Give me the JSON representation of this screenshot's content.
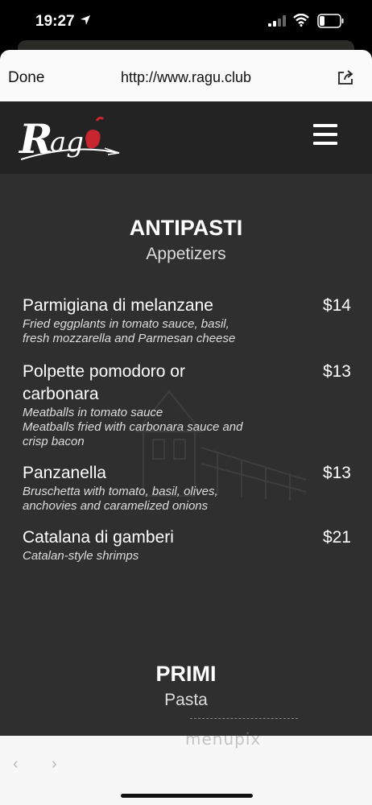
{
  "status_bar": {
    "time": "19:27"
  },
  "browser": {
    "done_label": "Done",
    "url": "http://www.ragu.club"
  },
  "site": {
    "logo_text": "Ragù"
  },
  "sections": [
    {
      "title": "ANTIPASTI",
      "subtitle": "Appetizers",
      "items": [
        {
          "name": "Parmigiana di melanzane",
          "price": "$14",
          "desc": [
            "Fried eggplants in tomato sauce, basil,",
            "fresh mozzarella and Parmesan cheese"
          ]
        },
        {
          "name": "Polpette pomodoro or carbonara",
          "price": "$13",
          "desc": [
            "Meatballs in tomato sauce",
            "Meatballs fried with carbonara sauce and",
            "crisp bacon"
          ]
        },
        {
          "name": "Panzanella",
          "price": "$13",
          "desc": [
            "Bruschetta with tomato, basil, olives,",
            "anchovies and caramelized onions"
          ]
        },
        {
          "name": "Catalana di gamberi",
          "price": "$21",
          "desc": [
            "Catalan-style shrimps"
          ]
        }
      ]
    },
    {
      "title": "PRIMI",
      "subtitle": "Pasta"
    }
  ],
  "watermark": "menupix"
}
